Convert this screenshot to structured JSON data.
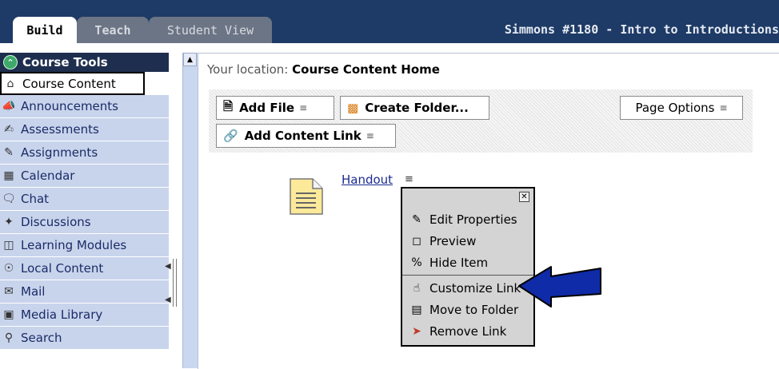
{
  "tabs": [
    {
      "label": "Build"
    },
    {
      "label": "Teach"
    },
    {
      "label": "Student View"
    }
  ],
  "course_title": "Simmons #1180 - Intro to Introductions",
  "sidebar": {
    "header": "Course Tools",
    "items": [
      {
        "label": "Course Content",
        "icon": "home-icon",
        "selected": true
      },
      {
        "label": "Announcements",
        "icon": "megaphone-icon"
      },
      {
        "label": "Assessments",
        "icon": "assessment-icon"
      },
      {
        "label": "Assignments",
        "icon": "assignment-icon"
      },
      {
        "label": "Calendar",
        "icon": "calendar-icon"
      },
      {
        "label": "Chat",
        "icon": "chat-bubble-icon"
      },
      {
        "label": "Discussions",
        "icon": "pin-icon"
      },
      {
        "label": "Learning Modules",
        "icon": "modules-icon"
      },
      {
        "label": "Local Content",
        "icon": "disc-icon"
      },
      {
        "label": "Mail",
        "icon": "mail-icon"
      },
      {
        "label": "Media Library",
        "icon": "library-icon"
      },
      {
        "label": "Search",
        "icon": "search-icon"
      }
    ]
  },
  "location": {
    "prefix": "Your location:",
    "current": "Course Content Home"
  },
  "toolbar": {
    "add_file": "Add File",
    "create_folder": "Create Folder...",
    "page_options": "Page Options",
    "add_content_link": "Add Content Link"
  },
  "content_item": {
    "label": "Handout",
    "icon": "document-icon"
  },
  "context_menu": {
    "items": [
      {
        "label": "Edit Properties",
        "icon": "pencil-icon"
      },
      {
        "label": "Preview",
        "icon": "preview-icon"
      },
      {
        "label": "Hide Item",
        "icon": "hide-icon"
      },
      {
        "label": "Customize Link",
        "icon": "hand-icon"
      },
      {
        "label": "Move to Folder",
        "icon": "move-folder-icon"
      },
      {
        "label": "Remove Link",
        "icon": "remove-icon"
      }
    ]
  },
  "colors": {
    "top_bar": "#1e3a66",
    "sidebar_item": "#c8d4ec",
    "sidebar_header": "#1e2e4e",
    "link": "#1b2b8f",
    "arrow": "#0f2ba8"
  }
}
